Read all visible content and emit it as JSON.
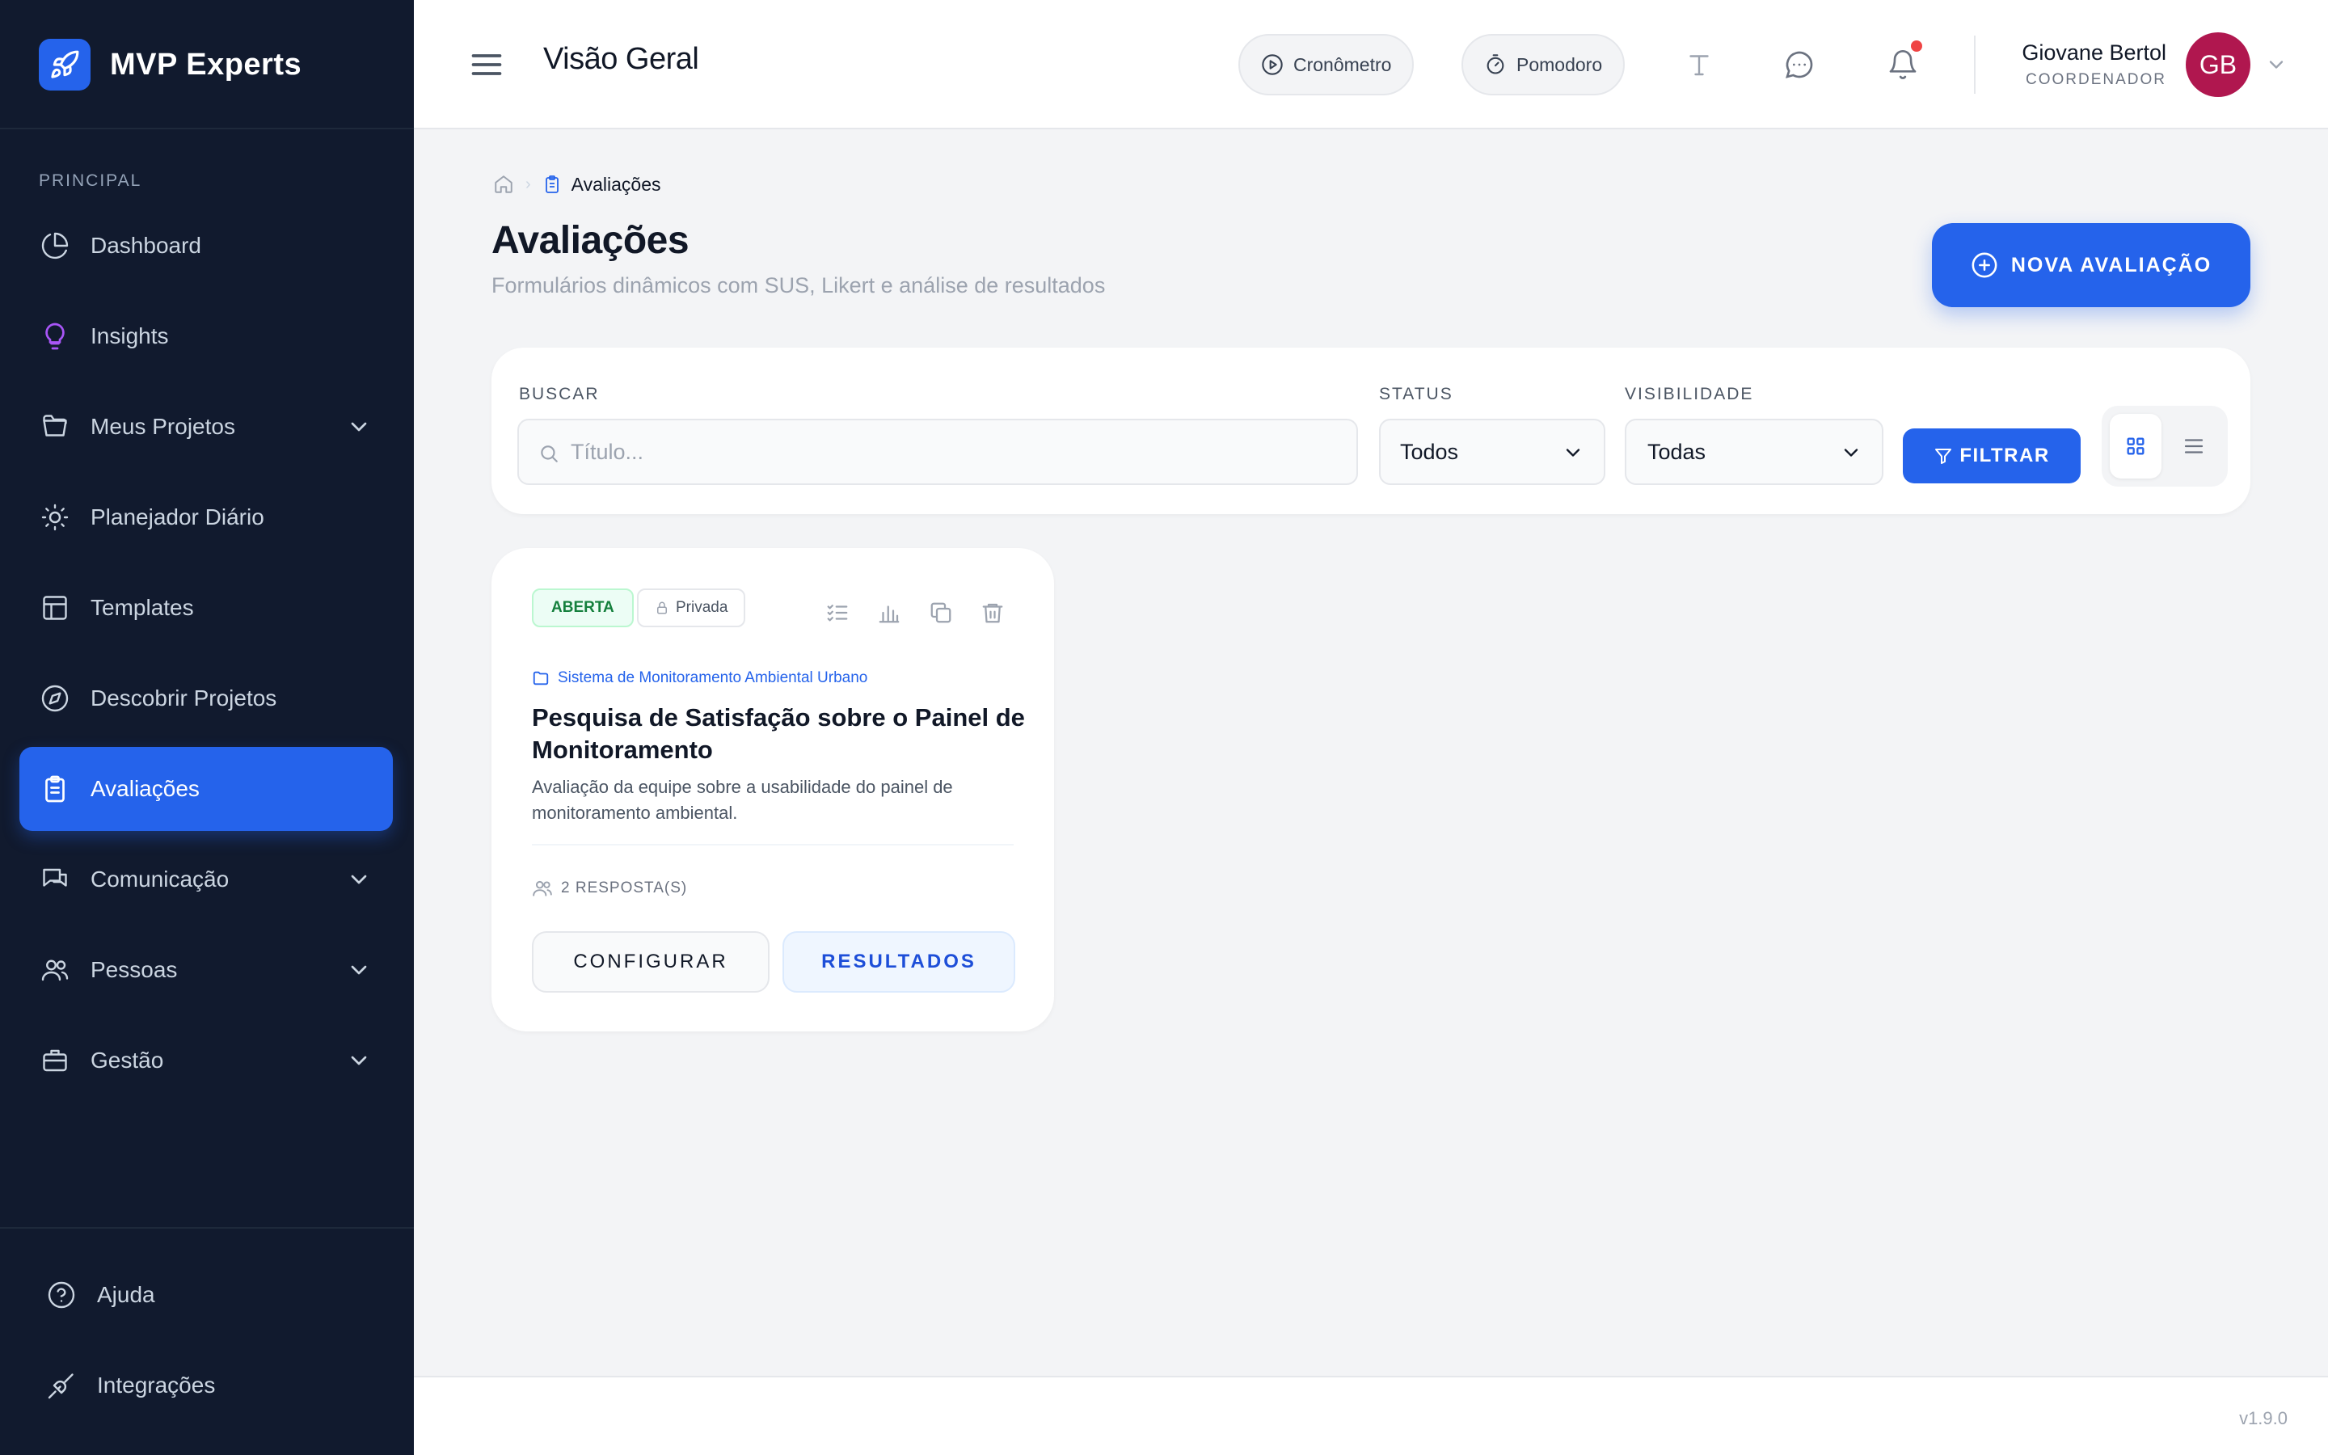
{
  "brand": {
    "name": "MVP Experts"
  },
  "sidebar": {
    "section_label": "PRINCIPAL",
    "items": [
      {
        "label": "Dashboard",
        "icon": "pie-chart-icon"
      },
      {
        "label": "Insights",
        "icon": "lightbulb-icon"
      },
      {
        "label": "Meus Projetos",
        "icon": "folder-icon",
        "expandable": true
      },
      {
        "label": "Planejador Diário",
        "icon": "sun-icon"
      },
      {
        "label": "Templates",
        "icon": "layout-icon"
      },
      {
        "label": "Descobrir Projetos",
        "icon": "compass-icon"
      },
      {
        "label": "Avaliações",
        "icon": "clipboard-icon",
        "active": true
      },
      {
        "label": "Comunicação",
        "icon": "chat-icon",
        "expandable": true
      },
      {
        "label": "Pessoas",
        "icon": "users-icon",
        "expandable": true
      },
      {
        "label": "Gestão",
        "icon": "briefcase-icon",
        "expandable": true
      }
    ],
    "bottom_items": [
      {
        "label": "Ajuda",
        "icon": "help-circle-icon"
      },
      {
        "label": "Integrações",
        "icon": "plug-icon"
      }
    ]
  },
  "topbar": {
    "title": "Visão Geral",
    "timer_label": "Cronômetro",
    "pomodoro_label": "Pomodoro",
    "user": {
      "name": "Giovane Bertol",
      "role": "COORDENADOR",
      "initials": "GB",
      "avatar_color": "#b0174f"
    }
  },
  "breadcrumb": {
    "current": "Avaliações"
  },
  "page": {
    "title": "Avaliações",
    "subtitle": "Formulários dinâmicos com SUS, Likert e análise de resultados",
    "new_button": "NOVA AVALIAÇÃO"
  },
  "filters": {
    "search_label": "BUSCAR",
    "search_placeholder": "Título...",
    "status_label": "STATUS",
    "status_value": "Todos",
    "visibility_label": "VISIBILIDADE",
    "visibility_value": "Todas",
    "filter_button": "FILTRAR",
    "view_mode": "grid"
  },
  "cards": [
    {
      "status": "ABERTA",
      "visibility": "Privada",
      "project": "Sistema de Monitoramento Ambiental Urbano",
      "title": "Pesquisa de Satisfação sobre o Painel de Monitoramento",
      "description": "Avaliação da equipe sobre a usabilidade do painel de monitoramento ambiental.",
      "responses": "2 RESPOSTA(S)",
      "config_button": "CONFIGURAR",
      "results_button": "RESULTADOS"
    }
  ],
  "footer": {
    "version": "v1.9.0"
  },
  "colors": {
    "accent": "#2563eb",
    "sidebar_bg": "#111a2e",
    "status_open": "#15803d"
  }
}
